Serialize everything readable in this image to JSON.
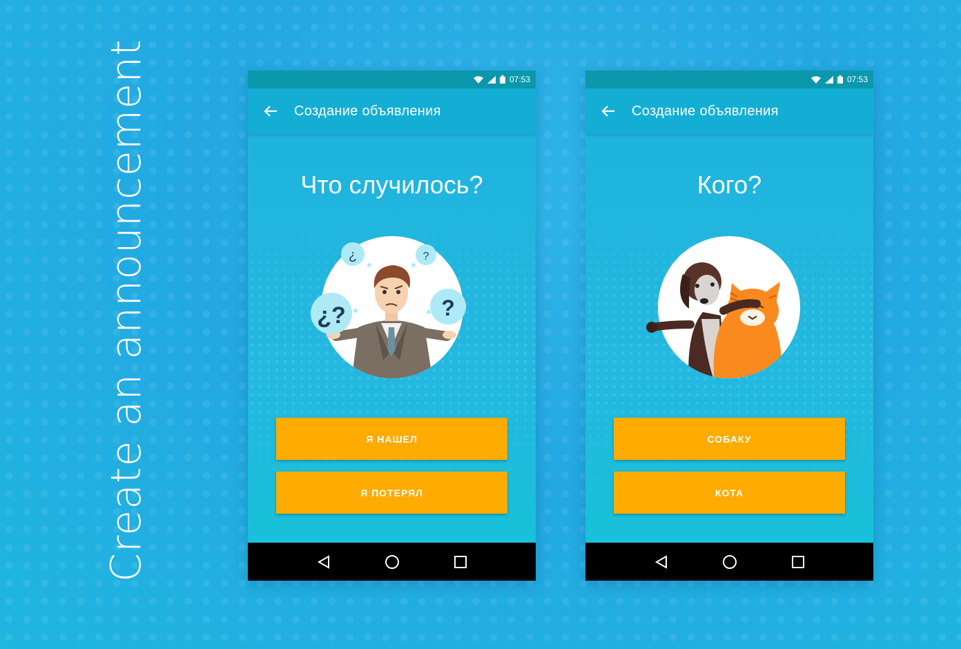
{
  "side_title": "Create an announcement",
  "colors": {
    "accent": "#ffab00",
    "toolbar": "#14aed4",
    "statusbar": "#0b98ad",
    "background": "#23a8e2"
  },
  "screens": [
    {
      "status": {
        "time": "07:53",
        "icons": [
          "wifi-icon",
          "signal-icon",
          "battery-icon"
        ]
      },
      "toolbar": {
        "back_icon": "arrow-back-icon",
        "title": "Создание объявления"
      },
      "question": "Что случилось?",
      "illustration": "confused-man",
      "bubbles": [
        "¿",
        "?",
        "¿?",
        "?"
      ],
      "buttons": [
        "Я НАШЕЛ",
        "Я ПОТЕРЯЛ"
      ],
      "nav": [
        "back-triangle-icon",
        "home-circle-icon",
        "recents-square-icon"
      ]
    },
    {
      "status": {
        "time": "07:53",
        "icons": [
          "wifi-icon",
          "signal-icon",
          "battery-icon"
        ]
      },
      "toolbar": {
        "back_icon": "arrow-back-icon",
        "title": "Создание объявления"
      },
      "question": "Кого?",
      "illustration": "dog-and-cat",
      "buttons": [
        "СОБАКУ",
        "КОТА"
      ],
      "nav": [
        "back-triangle-icon",
        "home-circle-icon",
        "recents-square-icon"
      ]
    }
  ]
}
